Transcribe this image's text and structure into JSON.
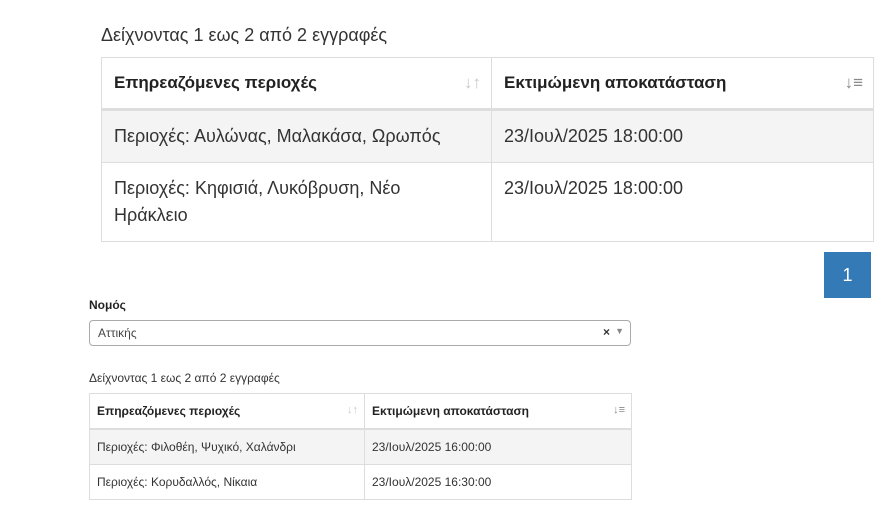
{
  "region1": {
    "info": "Δείχνοντας 1 εως 2 από 2 εγγραφές",
    "headers": [
      "Επηρεαζόμενες περιοχές",
      "Εκτιμώμενη αποκατάσταση"
    ],
    "sort_icons": [
      "sort-both-icon",
      "sort-desc-icon"
    ],
    "rows": [
      {
        "area": "Περιοχές: Αυλώνας, Μαλακάσα, Ωρωπός",
        "time": "23/Ιουλ/2025 18:00:00"
      },
      {
        "area": "Περιοχές: Κηφισιά, Λυκόβρυση, Νέο Ηράκλειο",
        "time": "23/Ιουλ/2025 18:00:00"
      }
    ],
    "pagination": {
      "current_page": "1"
    }
  },
  "nomos": {
    "label": "Νομός",
    "selected": "Αττικής",
    "clear_symbol": "×",
    "arrow_symbol": "▼"
  },
  "region2": {
    "info": "Δείχνοντας 1 εως 2 από 2 εγγραφές",
    "headers": [
      "Επηρεαζόμενες περιοχές",
      "Εκτιμώμενη αποκατάσταση"
    ],
    "rows": [
      {
        "area": "Περιοχές: Φιλοθέη, Ψυχικό, Χαλάνδρι",
        "time": "23/Ιουλ/2025 16:00:00"
      },
      {
        "area": "Περιοχές: Κορυδαλλός, Νίκαια",
        "time": "23/Ιουλ/2025 16:30:00"
      }
    ]
  },
  "colors": {
    "accent": "#337ab7",
    "stripe": "#f4f4f4",
    "border": "#dddddd"
  }
}
